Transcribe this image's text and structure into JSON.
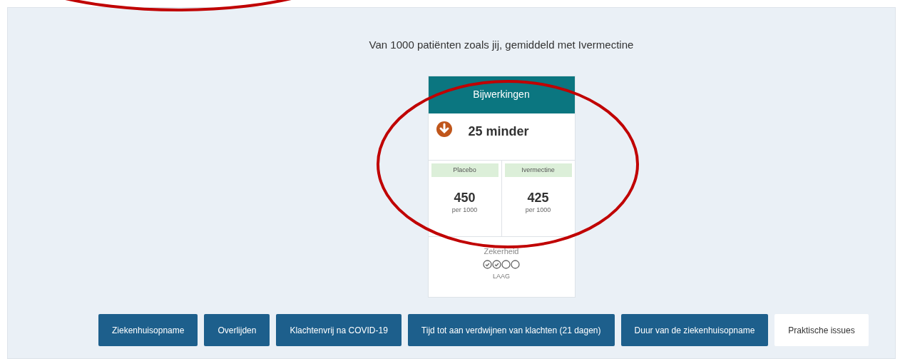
{
  "heading": "Van 1000 patiënten zoals jij, gemiddeld met Ivermectine",
  "card": {
    "title": "Bijwerkingen",
    "effect": "25 minder",
    "groups": [
      {
        "label": "Placebo",
        "value": "450",
        "unit": "per 1000"
      },
      {
        "label": "Ivermectine",
        "value": "425",
        "unit": "per 1000"
      }
    ],
    "certainty": {
      "label": "Zekerheid",
      "circles": [
        {
          "checked": true
        },
        {
          "checked": true
        },
        {
          "checked": false
        },
        {
          "checked": false
        }
      ],
      "rating": "LAAG"
    }
  },
  "tabs": [
    {
      "label": "Ziekenhuisopname",
      "selected": false
    },
    {
      "label": "Overlijden",
      "selected": false
    },
    {
      "label": "Klachtenvrij na COVID-19",
      "selected": false
    },
    {
      "label": "Tijd tot aan verdwijnen van klachten (21 dagen)",
      "selected": false
    },
    {
      "label": "Duur van de ziekenhuisopname",
      "selected": false
    },
    {
      "label": "Praktische issues",
      "selected": true
    }
  ]
}
